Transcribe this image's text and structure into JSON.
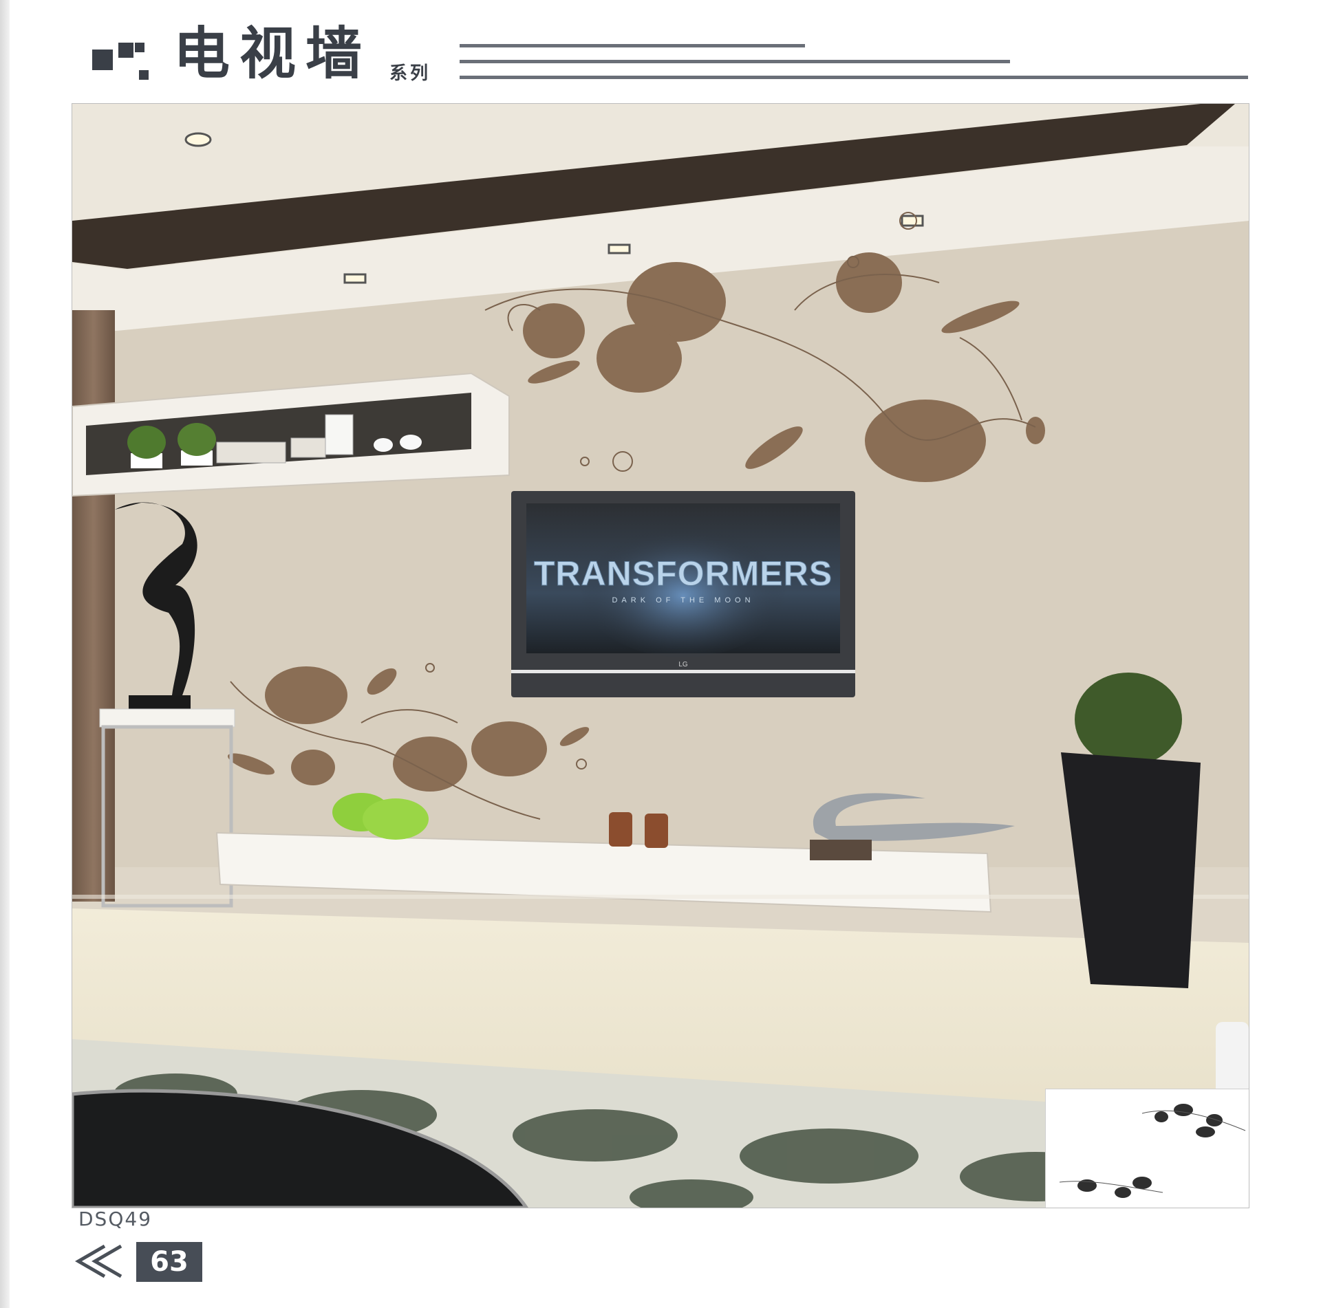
{
  "header": {
    "title": "电视墙",
    "subtitle": "系列"
  },
  "photo": {
    "tv_screen": {
      "title": "TRANSFORMERS",
      "subtitle": "DARK OF THE MOON",
      "brand": "LG"
    },
    "model_code": "DSQ49"
  },
  "footer": {
    "page_number": "63"
  },
  "colors": {
    "header_text": "#3a3f47",
    "wall": "#d8cfbf",
    "flower_decal": "#8a6e55",
    "page_badge": "#474d56"
  }
}
